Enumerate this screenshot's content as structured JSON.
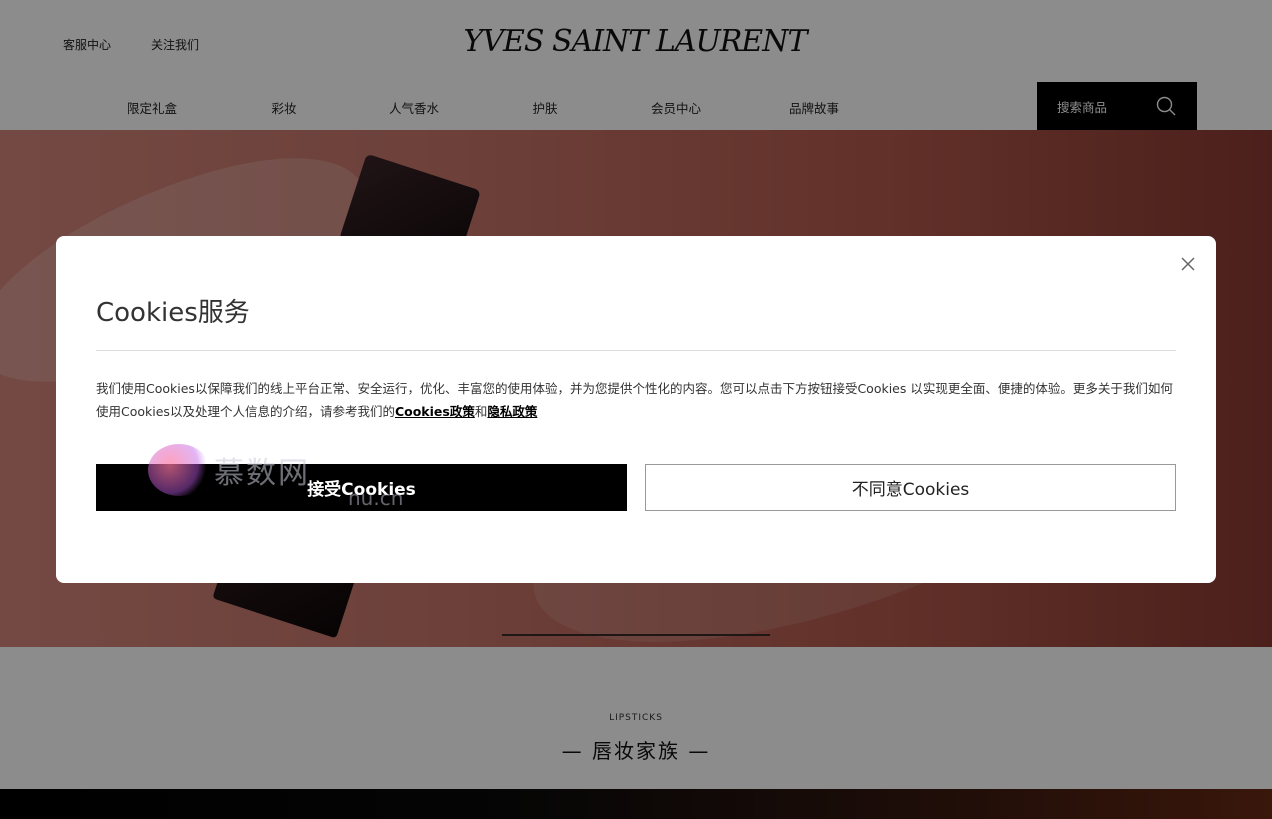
{
  "header": {
    "top_links": [
      "客服中心",
      "关注我们"
    ],
    "logo_text": "YVES SAINT LAURENT",
    "nav_items": [
      "限定礼盒",
      "彩妆",
      "人气香水",
      "护肤",
      "会员中心",
      "品牌故事"
    ],
    "search": {
      "label": "搜索商品",
      "icon": "search-icon"
    }
  },
  "section": {
    "eyebrow": "LIPSTICKS",
    "title": "— 唇妆家族 —"
  },
  "modal": {
    "title": "Cookies服务",
    "body_text": "我们使用Cookies以保障我们的线上平台正常、安全运行，优化、丰富您的使用体验，并为您提供个性化的内容。您可以点击下方按钮接受Cookies 以实现更全面、便捷的体验。更多关于我们如何使用Cookies以及处理个人信息的介绍，请参考我们的",
    "cookie_policy_link": "Cookies政策",
    "conjunction": "和",
    "privacy_policy_link": "隐私政策",
    "accept_label": "接受Cookies",
    "decline_label": "不同意Cookies",
    "close_icon": "close-icon"
  },
  "watermark": {
    "text": "慕数网",
    "url": "nu.cn"
  },
  "colors": {
    "overlay": "#000000",
    "accept_bg": "#000000",
    "search_bg": "#000000",
    "hero": "#c7766a"
  }
}
